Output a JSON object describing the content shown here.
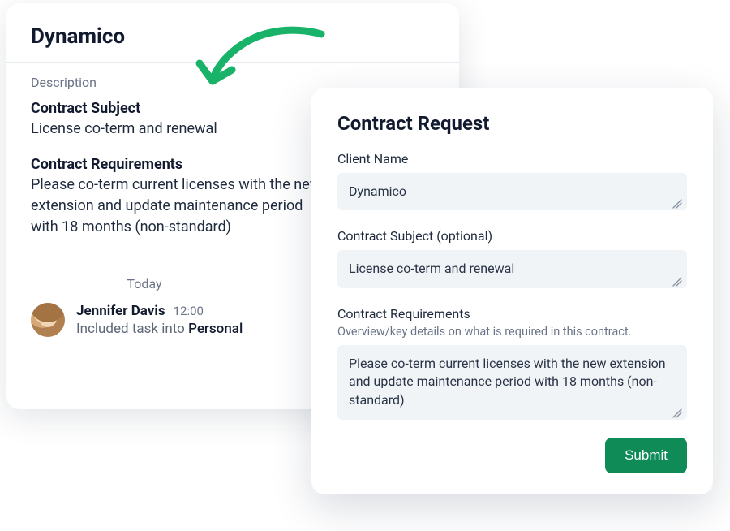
{
  "back": {
    "title": "Dynamico",
    "description_label": "Description",
    "subject_heading": "Contract Subject",
    "subject_value": "License co-term and renewal",
    "requirements_heading": "Contract Requirements",
    "requirements_value": "Please co-term current licenses with the new extension and update maintenance period with 18 months (non-standard)",
    "today_label": "Today",
    "activity": {
      "user": "Jennifer Davis",
      "time": "12:00",
      "action": "Included task into",
      "target": "Personal"
    }
  },
  "form": {
    "title": "Contract Request",
    "client_name_label": "Client Name",
    "client_name_value": "Dynamico",
    "subject_label": "Contract Subject (optional)",
    "subject_value": "License co-term and renewal",
    "requirements_label": "Contract Requirements",
    "requirements_desc": "Overview/key details on what is required in this contract.",
    "requirements_value": "Please co-term current licenses with the new extension and update maintenance period with 18 months (non-standard)",
    "submit_label": "Submit"
  },
  "colors": {
    "accent_green": "#18b268",
    "submit_green": "#0f8b58"
  }
}
